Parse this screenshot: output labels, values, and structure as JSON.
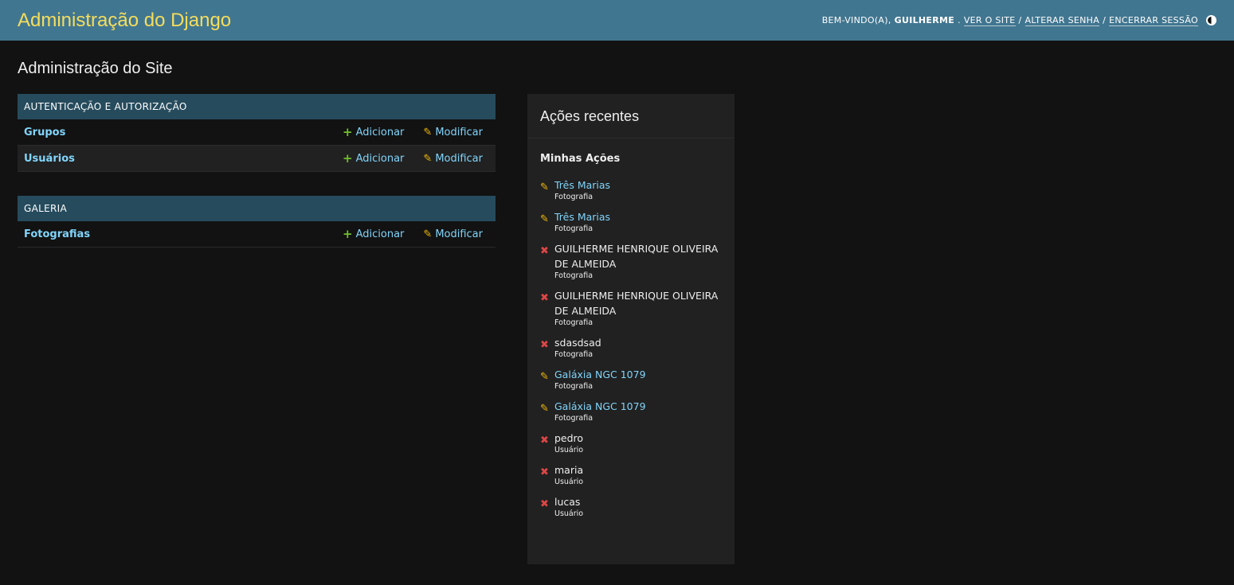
{
  "header": {
    "branding": "Administração do Django",
    "welcome": "Bem-vindo(a),",
    "username": "Guilherme",
    "view_site": "Ver o site",
    "change_password": "Alterar senha",
    "logout": "Encerrar sessão",
    "theme_icon": "contrast-icon"
  },
  "page_title": "Administração do Site",
  "modules": [
    {
      "caption": "Autenticação e Autorização",
      "rows": [
        {
          "model": "Grupos",
          "add": "Adicionar",
          "change": "Modificar"
        },
        {
          "model": "Usuários",
          "add": "Adicionar",
          "change": "Modificar"
        }
      ]
    },
    {
      "caption": "Galeria",
      "rows": [
        {
          "model": "Fotografias",
          "add": "Adicionar",
          "change": "Modificar"
        }
      ]
    }
  ],
  "recent": {
    "title": "Ações recentes",
    "subtitle": "Minhas Ações",
    "items": [
      {
        "kind": "edit",
        "name": "Três Marias",
        "type": "Fotografia"
      },
      {
        "kind": "edit",
        "name": "Três Marias",
        "type": "Fotografia"
      },
      {
        "kind": "delete",
        "name": "GUILHERME HENRIQUE OLIVEIRA DE ALMEIDA",
        "type": "Fotografia"
      },
      {
        "kind": "delete",
        "name": "GUILHERME HENRIQUE OLIVEIRA DE ALMEIDA",
        "type": "Fotografia"
      },
      {
        "kind": "delete",
        "name": "sdasdsad",
        "type": "Fotografia"
      },
      {
        "kind": "edit",
        "name": "Galáxia NGC 1079",
        "type": "Fotografia"
      },
      {
        "kind": "edit",
        "name": "Galáxia NGC 1079",
        "type": "Fotografia"
      },
      {
        "kind": "delete",
        "name": "pedro",
        "type": "Usuário"
      },
      {
        "kind": "delete",
        "name": "maria",
        "type": "Usuário"
      },
      {
        "kind": "delete",
        "name": "lucas",
        "type": "Usuário"
      }
    ]
  },
  "colors": {
    "header_bg": "#417690",
    "branding": "#f5dd5d",
    "caption_bg": "#264b5d",
    "link": "#81d4fa",
    "add": "#70bf2b",
    "edit": "#efb80b",
    "delete": "#dd4646"
  }
}
